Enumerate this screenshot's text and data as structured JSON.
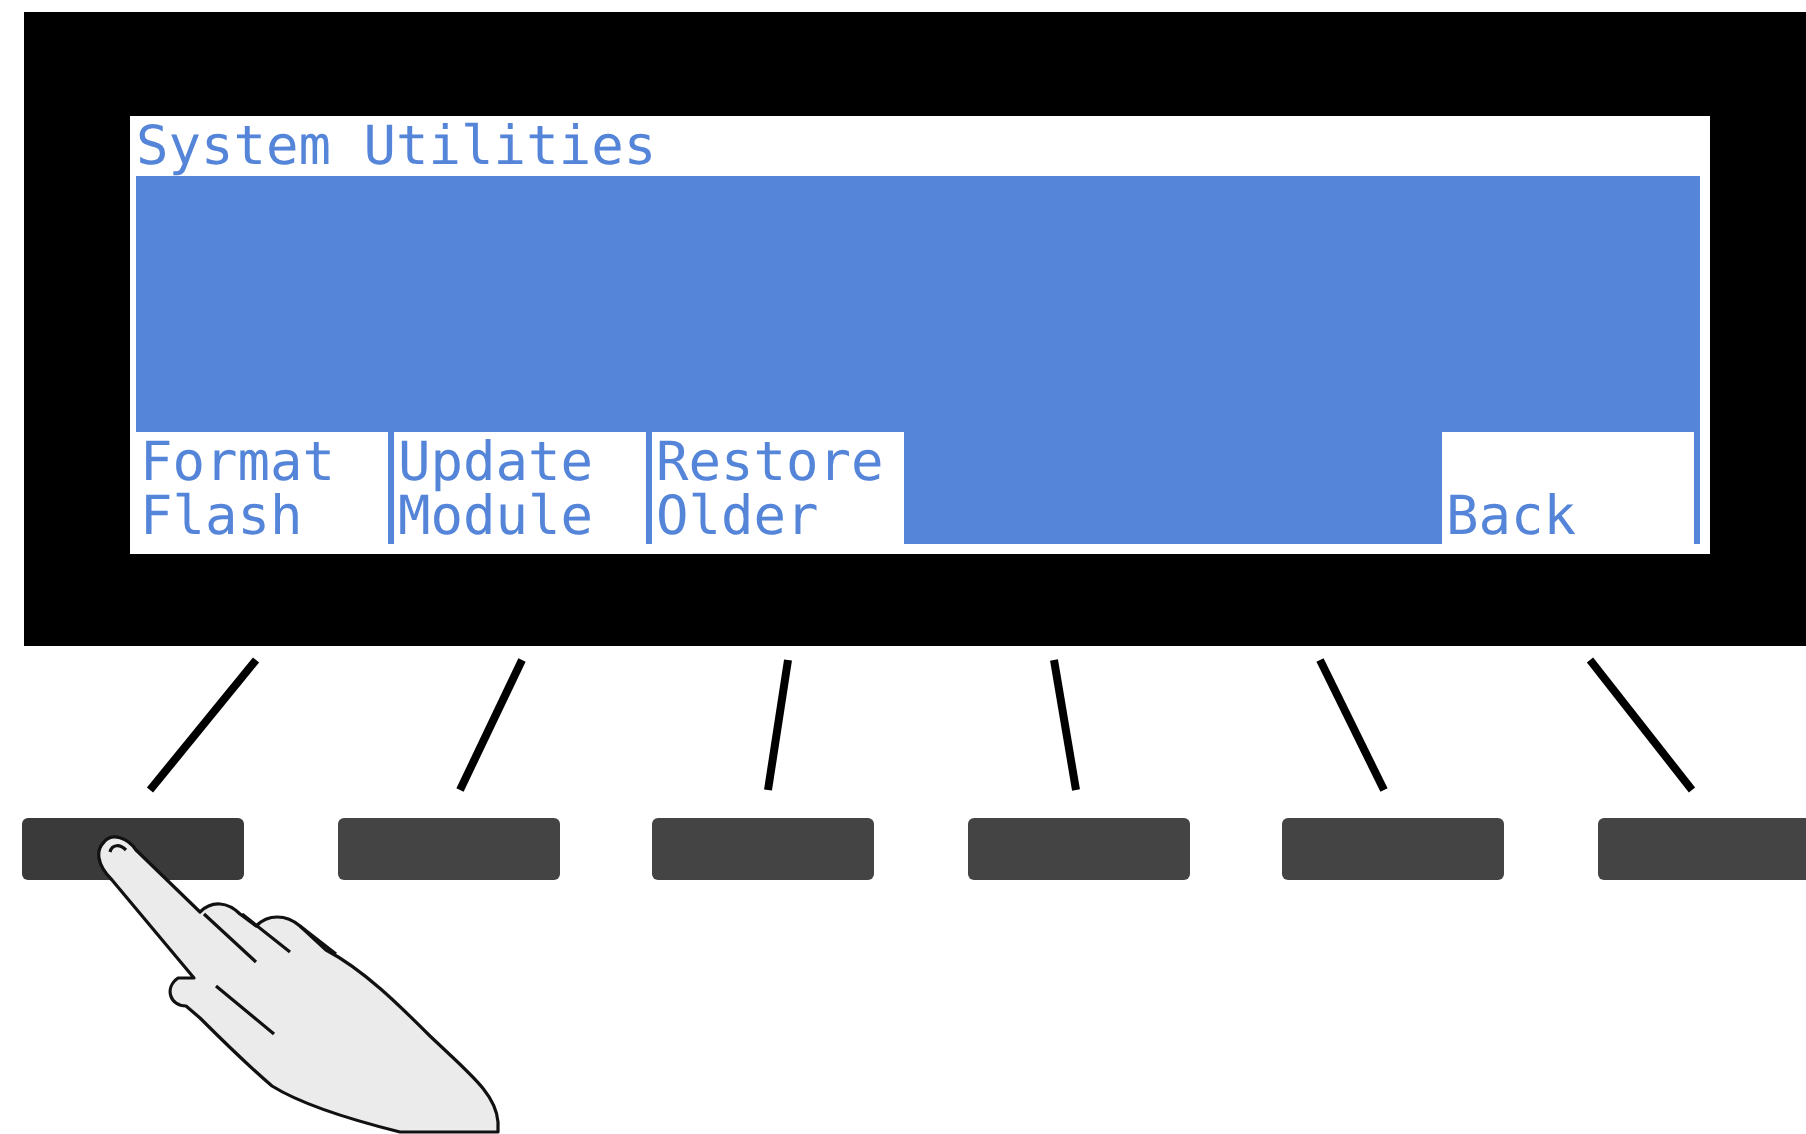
{
  "screen": {
    "title": "System Utilities"
  },
  "softkeys": [
    {
      "kind": "label",
      "lines": [
        "Format",
        "Flash"
      ],
      "pressed": true
    },
    {
      "kind": "label",
      "lines": [
        "Update",
        "Module"
      ],
      "pressed": false
    },
    {
      "kind": "label",
      "lines": [
        "Restore",
        "Older"
      ],
      "pressed": false
    },
    {
      "kind": "blank",
      "pressed": false
    },
    {
      "kind": "wide",
      "pressed": false
    },
    {
      "kind": "label",
      "lines": [
        "Back"
      ],
      "pressed": false
    }
  ]
}
